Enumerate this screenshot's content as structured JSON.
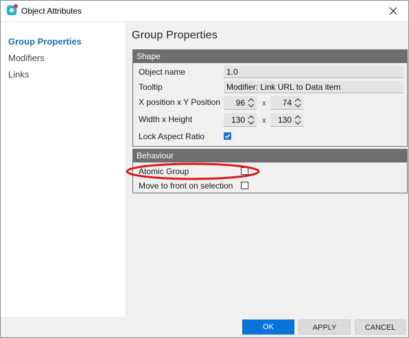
{
  "window": {
    "title": "Object Attributes",
    "app_icon": "app-logo-icon",
    "close_icon": "close-icon"
  },
  "nav": {
    "items": [
      {
        "label": "Group Properties",
        "active": true
      },
      {
        "label": "Modifiers",
        "active": false
      },
      {
        "label": "Links",
        "active": false
      }
    ]
  },
  "main": {
    "title": "Group Properties",
    "shape": {
      "header": "Shape",
      "object_name_label": "Object name",
      "object_name_value": "1.0",
      "tooltip_label": "Tooltip",
      "tooltip_value": "Modifier: Link URL to Data item",
      "position_label": "X position x Y Position",
      "x_position": "96",
      "y_position": "74",
      "size_label": "Width x Height",
      "width": "130",
      "height": "130",
      "separator": "x",
      "lock_aspect_label": "Lock Aspect Ratio",
      "lock_aspect_checked": true
    },
    "behaviour": {
      "header": "Behaviour",
      "atomic_group_label": "Atomic Group",
      "atomic_group_checked": false,
      "move_front_label": "Move to front on selection",
      "move_front_checked": false
    }
  },
  "footer": {
    "ok_label": "OK",
    "apply_label": "APPLY",
    "cancel_label": "CANCEL"
  },
  "colors": {
    "accent": "#0a74da",
    "nav_active": "#1e6fb8",
    "group_header": "#6e6e6e",
    "annotation": "#e0141e"
  }
}
